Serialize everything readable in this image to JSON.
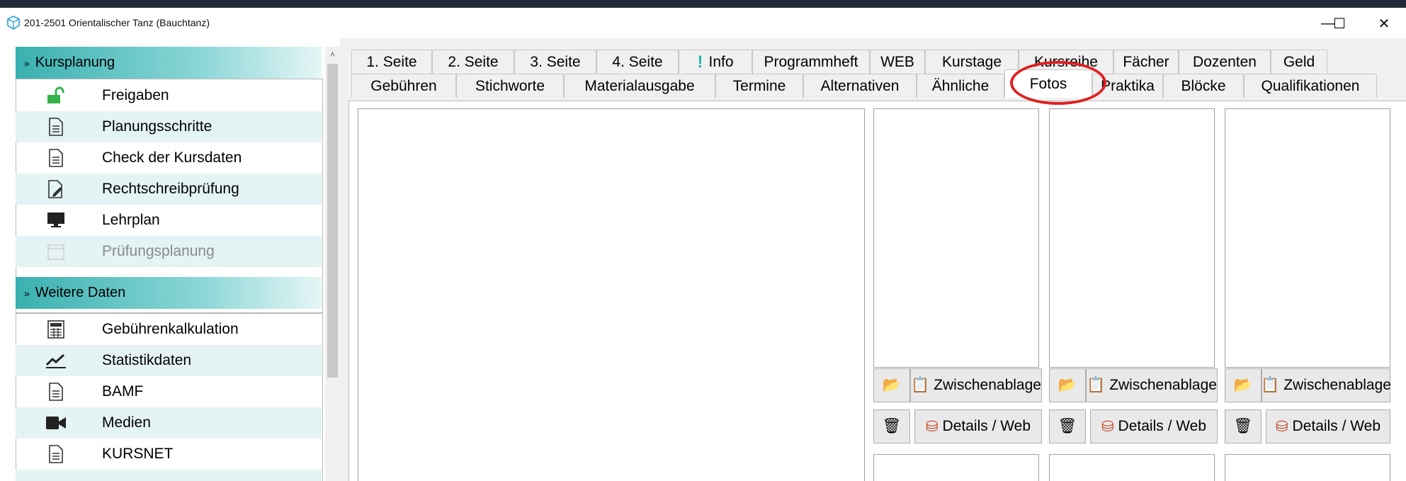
{
  "window": {
    "title": "201-2501 Orientalischer Tanz (Bauchtanz)",
    "minimize": "—",
    "maximize": "☐",
    "close": "✕"
  },
  "sidebar": {
    "sections": [
      {
        "label": "Kursplanung",
        "items": [
          {
            "label": "Freigaben",
            "icon": "unlock-icon",
            "disabled": false
          },
          {
            "label": "Planungsschritte",
            "icon": "document-icon",
            "disabled": false
          },
          {
            "label": "Check der Kursdaten",
            "icon": "document-icon",
            "disabled": false
          },
          {
            "label": "Rechtschreibprüfung",
            "icon": "edit-document-icon",
            "disabled": false
          },
          {
            "label": "Lehrplan",
            "icon": "monitor-icon",
            "disabled": false
          },
          {
            "label": "Prüfungsplanung",
            "icon": "calendar-icon",
            "disabled": true
          }
        ]
      },
      {
        "label": "Weitere Daten",
        "items": [
          {
            "label": "Gebührenkalkulation",
            "icon": "calculator-icon",
            "disabled": false
          },
          {
            "label": "Statistikdaten",
            "icon": "chart-icon",
            "disabled": false
          },
          {
            "label": "BAMF",
            "icon": "document-icon",
            "disabled": false
          },
          {
            "label": "Medien",
            "icon": "video-camera-icon",
            "disabled": false
          },
          {
            "label": "KURSNET",
            "icon": "document-icon",
            "disabled": false
          }
        ]
      }
    ]
  },
  "tabs": {
    "row1": [
      "1. Seite",
      "2. Seite",
      "3. Seite",
      "4. Seite",
      "Info",
      "Programmheft",
      "WEB",
      "Kurstage",
      "Kursreihe",
      "Fächer",
      "Dozenten",
      "Geld"
    ],
    "row2": [
      "Gebühren",
      "Stichworte",
      "Materialausgabe",
      "Termine",
      "Alternativen",
      "Ähnliche",
      "Fotos",
      "Praktika",
      "Blöcke",
      "Qualifikationen"
    ],
    "active": "Fotos"
  },
  "photos": {
    "clipboard_label": "Zwischenablage",
    "details_label": "Details / Web"
  },
  "colors": {
    "accent_teal": "#3ab0b0",
    "alt_row": "#e4f3f3",
    "highlight_red": "#e02020"
  }
}
